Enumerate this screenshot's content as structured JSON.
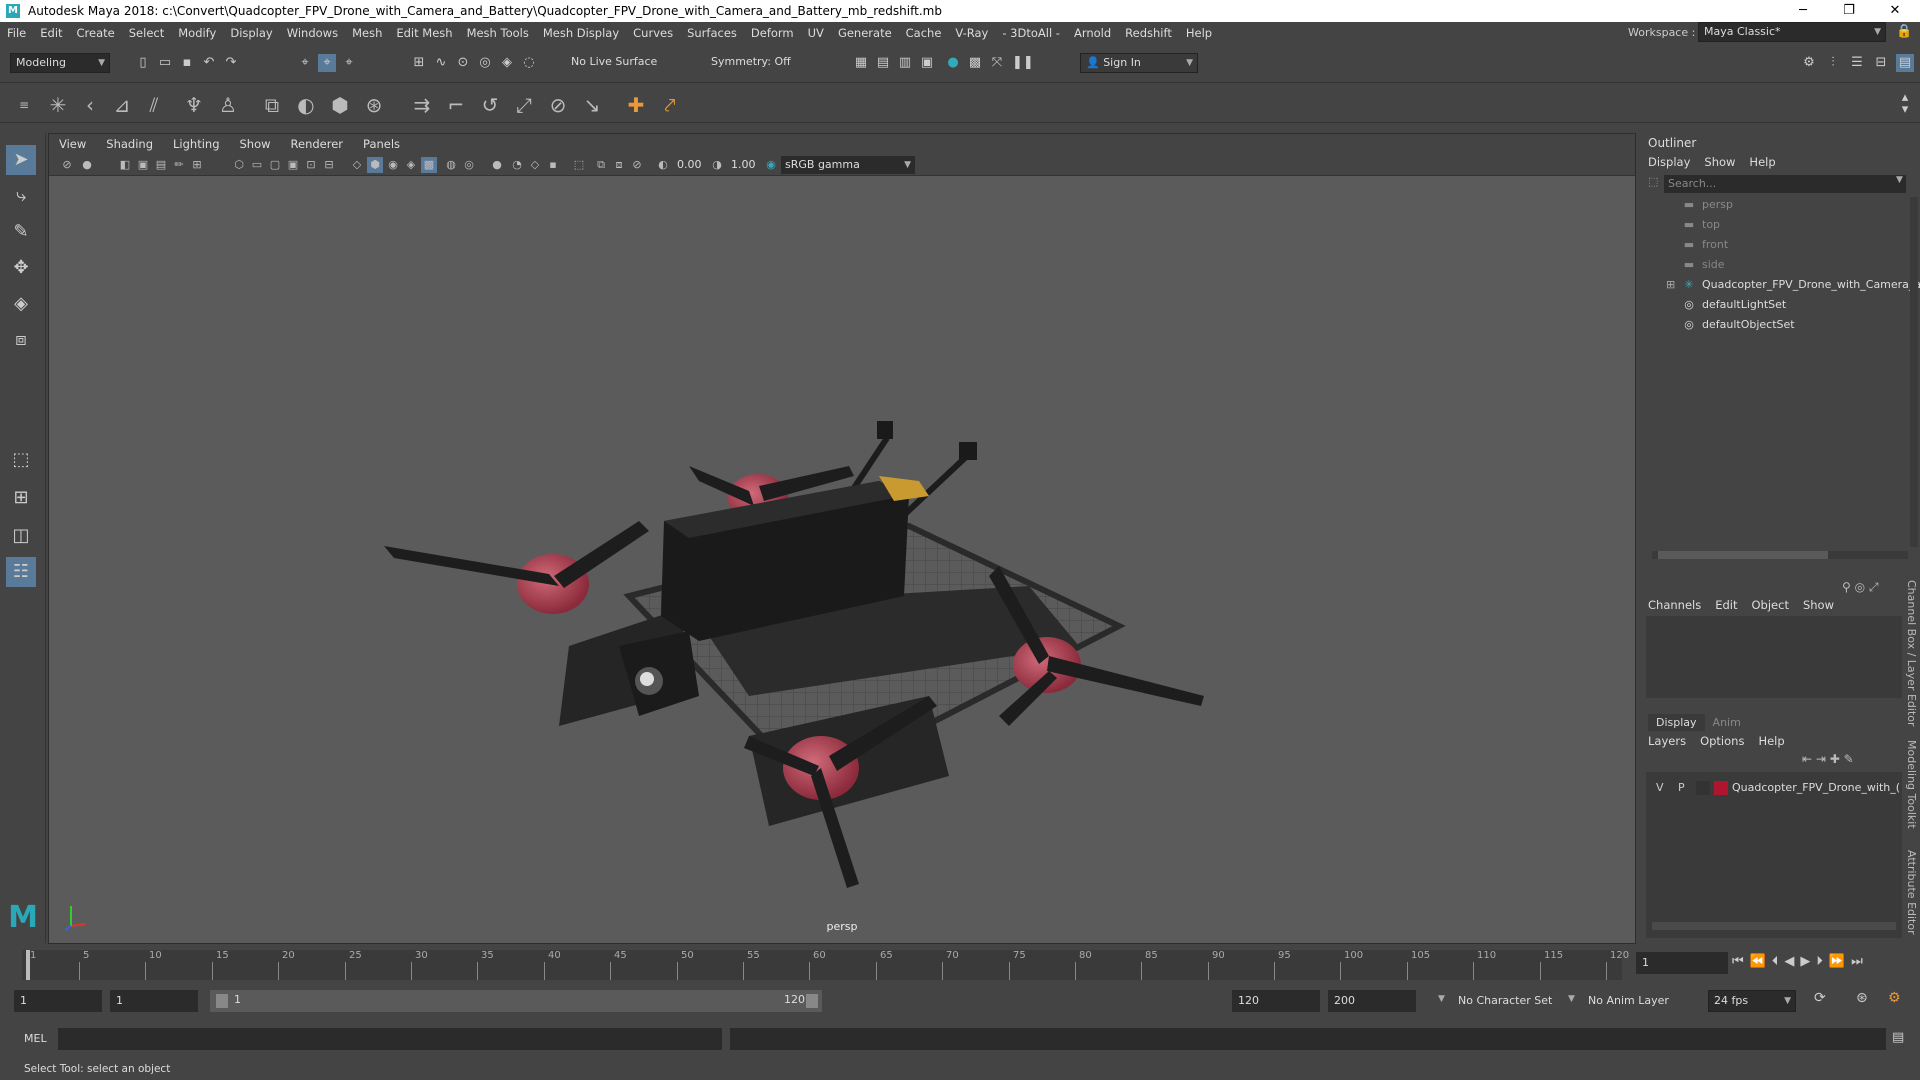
{
  "titlebar": {
    "title": "Autodesk Maya 2018: c:\\Convert\\Quadcopter_FPV_Drone_with_Camera_and_Battery\\Quadcopter_FPV_Drone_with_Camera_and_Battery_mb_redshift.mb",
    "logo": "M",
    "minimize": "─",
    "maximize": "❐",
    "close": "✕"
  },
  "menubar": {
    "items": [
      "File",
      "Edit",
      "Create",
      "Select",
      "Modify",
      "Display",
      "Windows",
      "Mesh",
      "Edit Mesh",
      "Mesh Tools",
      "Mesh Display",
      "Curves",
      "Surfaces",
      "Deform",
      "UV",
      "Generate",
      "Cache",
      "V-Ray",
      "- 3DtoAll -",
      "Arnold",
      "Redshift",
      "Help"
    ],
    "workspace_label": "Workspace :",
    "workspace_value": "Maya Classic*"
  },
  "statusline": {
    "mode": "Modeling",
    "live_surface": "No Live Surface",
    "symmetry": "Symmetry: Off",
    "sign_in": "Sign In"
  },
  "viewport": {
    "menus": [
      "View",
      "Shading",
      "Lighting",
      "Show",
      "Renderer",
      "Panels"
    ],
    "exposure": "0.00",
    "gamma": "1.00",
    "color_space": "sRGB gamma",
    "camera": "persp"
  },
  "outliner": {
    "title": "Outliner",
    "menus": [
      "Display",
      "Show",
      "Help"
    ],
    "search_placeholder": "Search...",
    "items": [
      {
        "label": "persp",
        "icon": "camera-icon",
        "dim": true
      },
      {
        "label": "top",
        "icon": "camera-icon",
        "dim": true
      },
      {
        "label": "front",
        "icon": "camera-icon",
        "dim": true
      },
      {
        "label": "side",
        "icon": "camera-icon",
        "dim": true
      },
      {
        "label": "Quadcopter_FPV_Drone_with_Camera_a",
        "icon": "group-icon",
        "dim": false
      },
      {
        "label": "defaultLightSet",
        "icon": "set-icon",
        "dim": false
      },
      {
        "label": "defaultObjectSet",
        "icon": "set-icon",
        "dim": false
      }
    ]
  },
  "channelbox": {
    "menus": [
      "Channels",
      "Edit",
      "Object",
      "Show"
    ]
  },
  "layers": {
    "tabs": [
      "Display",
      "Anim"
    ],
    "menus": [
      "Layers",
      "Options",
      "Help"
    ],
    "layer": {
      "v": "V",
      "p": "P",
      "name": "Quadcopter_FPV_Drone_with_(",
      "color": "#b01530"
    }
  },
  "side_tabs": [
    "Channel Box / Layer Editor",
    "Modeling Toolkit",
    "Attribute Editor"
  ],
  "timeslider": {
    "ticks": [
      "1",
      "5",
      "10",
      "15",
      "20",
      "25",
      "30",
      "35",
      "40",
      "45",
      "50",
      "55",
      "60",
      "65",
      "70",
      "75",
      "80",
      "85",
      "90",
      "95",
      "100",
      "105",
      "110",
      "115",
      "120"
    ],
    "current_frame": "1"
  },
  "range": {
    "start": "1",
    "inner_start": "1",
    "slider_start": "1",
    "slider_end": "120",
    "end": "120",
    "outer_end": "200",
    "character_set": "No Character Set",
    "anim_layer": "No Anim Layer",
    "fps": "24 fps"
  },
  "cmdline": {
    "label": "MEL"
  },
  "helpline": {
    "text": "Select Tool: select an object"
  }
}
